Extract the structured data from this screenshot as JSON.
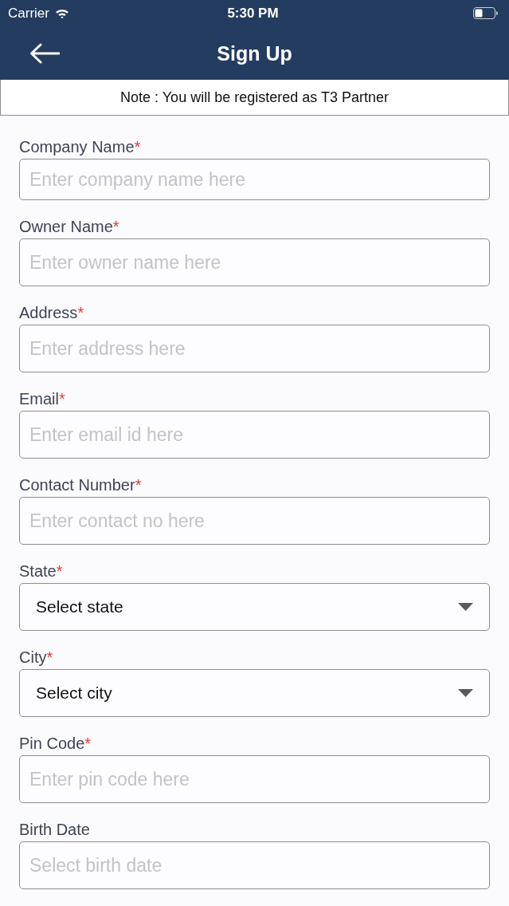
{
  "status_bar": {
    "carrier": "Carrier",
    "time": "5:30 PM"
  },
  "nav_bar": {
    "title": "Sign Up"
  },
  "note": "Note : You will be registered as T3 Partner",
  "fields": [
    {
      "kind": "text",
      "label": "Company Name",
      "required_mark": "*",
      "placeholder": "Enter company name here"
    },
    {
      "kind": "text",
      "label": "Owner Name",
      "required_mark": "*",
      "placeholder": "Enter owner name here"
    },
    {
      "kind": "text",
      "label": "Address",
      "required_mark": "*",
      "placeholder": "Enter address here"
    },
    {
      "kind": "text",
      "label": "Email",
      "required_mark": "*",
      "placeholder": "Enter email id here"
    },
    {
      "kind": "text",
      "label": "Contact Number",
      "required_mark": "*",
      "placeholder": "Enter contact no here"
    },
    {
      "kind": "select",
      "label": "State",
      "required_mark": "*",
      "value": "Select state"
    },
    {
      "kind": "select",
      "label": "City",
      "required_mark": "*",
      "value": "Select city"
    },
    {
      "kind": "text",
      "label": "Pin Code",
      "required_mark": "*",
      "placeholder": "Enter pin code here"
    },
    {
      "kind": "date",
      "label": "Birth Date",
      "placeholder": "Select birth date"
    }
  ]
}
